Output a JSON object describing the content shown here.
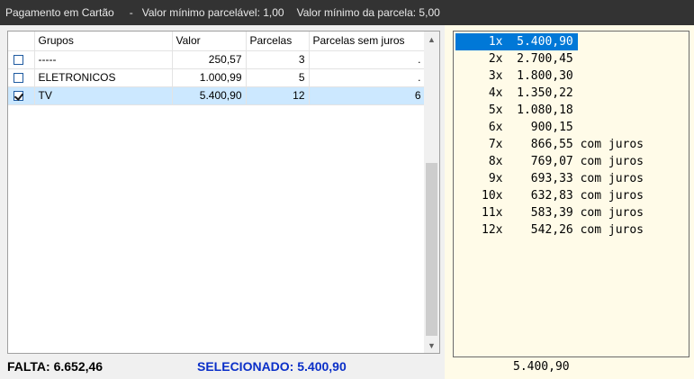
{
  "window": {
    "title": "Pagamento em Cartão",
    "separator": "-",
    "min_parcelavel": "Valor mínimo parcelável: 1,00",
    "min_parcela": "Valor mínimo da parcela: 5,00"
  },
  "grid": {
    "columns": [
      "Grupos",
      "Valor",
      "Parcelas",
      "Parcelas sem juros"
    ],
    "rows": [
      {
        "checked": false,
        "grupo": "-----",
        "valor": "250,57",
        "parcelas": "3",
        "sem_juros": "."
      },
      {
        "checked": false,
        "grupo": "ELETRONICOS",
        "valor": "1.000,99",
        "parcelas": "5",
        "sem_juros": "."
      },
      {
        "checked": true,
        "grupo": "TV",
        "valor": "5.400,90",
        "parcelas": "12",
        "sem_juros": "6"
      }
    ]
  },
  "status": {
    "falta": "FALTA: 6.652,46",
    "selecionado": "SELECIONADO: 5.400,90"
  },
  "installments": [
    " 1x  5.400,90",
    " 2x  2.700,45",
    " 3x  1.800,30",
    " 4x  1.350,22",
    " 5x  1.080,18",
    " 6x    900,15",
    " 7x    866,55 com juros",
    " 8x    769,07 com juros",
    " 9x    693,33 com juros",
    "10x    632,83 com juros",
    "11x    583,39 com juros",
    "12x    542,26 com juros"
  ],
  "installments_selected_index": 0,
  "total": "5.400,90",
  "colors": {
    "titlebar_bg": "#333333",
    "selection_blue": "#0078d7",
    "selected_row_bg": "#cce8ff",
    "selecionado_text": "#0a2fc8",
    "right_pane_bg": "#fffbe8"
  }
}
